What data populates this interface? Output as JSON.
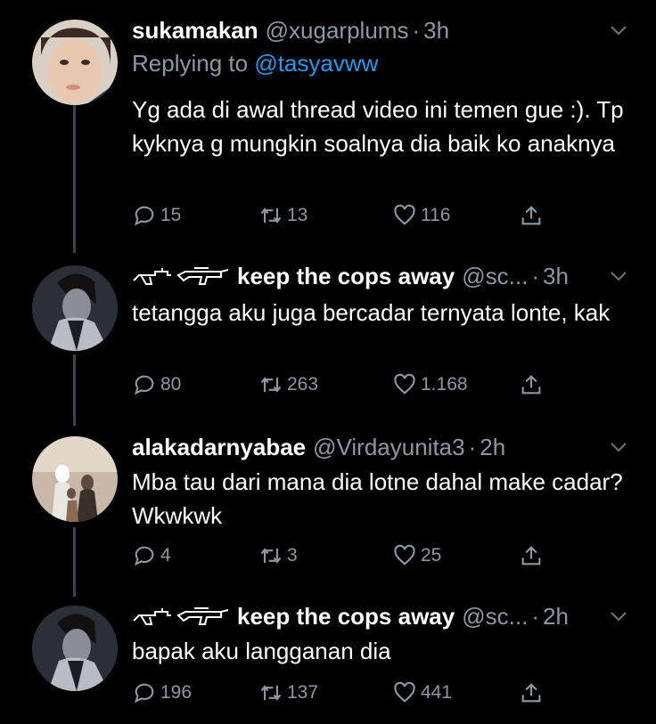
{
  "tweets": [
    {
      "name": "sukamakan",
      "handle": "@xugarplums",
      "time": "3h",
      "replying_label": "Replying to",
      "replying_to": "@tasyavww",
      "text": "Yg ada di awal thread video ini temen gue :). Tp kyknya g mungkin soalnya dia baik ko anaknya",
      "replies": "15",
      "retweets": "13",
      "likes": "116"
    },
    {
      "name": "keep the cops away",
      "handle": "@sc...",
      "time": "3h",
      "text": "tetangga aku juga bercadar ternyata lonte, kak",
      "replies": "80",
      "retweets": "263",
      "likes": "1.168"
    },
    {
      "name": "alakadarnyabae",
      "handle": "@Virdayunita3",
      "time": "2h",
      "text": "Mba tau dari mana dia lotne dahal make cadar? Wkwkwk",
      "replies": "4",
      "retweets": "3",
      "likes": "25"
    },
    {
      "name": "keep the cops away",
      "handle": "@sc...",
      "time": "2h",
      "text": "bapak aku langganan dia",
      "replies": "196",
      "retweets": "137",
      "likes": "441"
    }
  ],
  "colors": {
    "background": "#000000",
    "secondary_text": "#8b98a5",
    "mention": "#1d9bf0",
    "thread_line": "#3d4248"
  },
  "icons": [
    "reply-icon",
    "retweet-icon",
    "like-icon",
    "share-icon",
    "chevron-down-icon",
    "gun-emoji-icon"
  ]
}
